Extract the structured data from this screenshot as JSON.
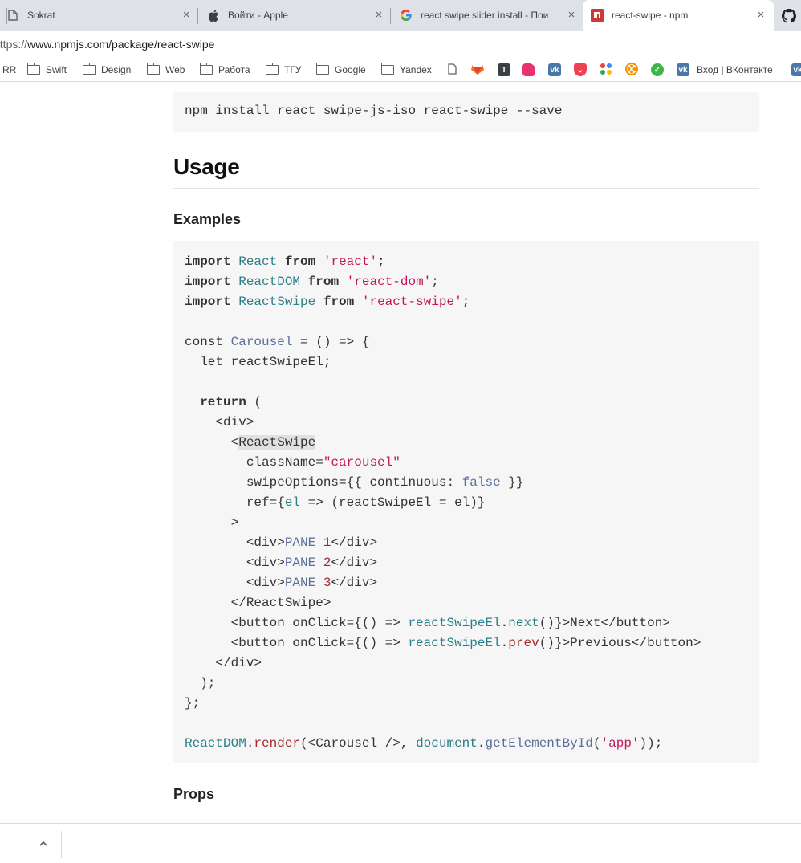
{
  "tabs": [
    {
      "title": "Sokrat",
      "icon": "document-icon",
      "close": "×"
    },
    {
      "title": "Войти - Apple",
      "icon": "apple-icon",
      "close": "×"
    },
    {
      "title": "react swipe slider install - Пои",
      "icon": "google-icon",
      "close": "×"
    },
    {
      "title": "react-swipe - npm",
      "icon": "npm-icon",
      "close": "×",
      "active": true
    }
  ],
  "address": {
    "url_dim": "https://",
    "url": "www.npmjs.com/package/react-swipe"
  },
  "bookmarks": [
    {
      "label": "RR",
      "type": "text"
    },
    {
      "label": "Swift",
      "type": "folder"
    },
    {
      "label": "Design",
      "type": "folder"
    },
    {
      "label": "Web",
      "type": "folder"
    },
    {
      "label": "Работа",
      "type": "folder"
    },
    {
      "label": "ТГУ",
      "type": "folder"
    },
    {
      "label": "Google",
      "type": "folder"
    },
    {
      "label": "Yandex",
      "type": "folder"
    },
    {
      "label": "",
      "type": "page-icon"
    },
    {
      "label": "",
      "type": "gitlab-icon"
    },
    {
      "label": "",
      "type": "tilda-icon"
    },
    {
      "label": "",
      "type": "pink-icon"
    },
    {
      "label": "",
      "type": "vk-icon"
    },
    {
      "label": "",
      "type": "pocket-icon"
    },
    {
      "label": "",
      "type": "dots-icon"
    },
    {
      "label": "",
      "type": "flower-icon"
    },
    {
      "label": "",
      "type": "green-icon"
    },
    {
      "label": "Вход | ВКонтакте",
      "type": "vk-icon"
    }
  ],
  "content": {
    "install_cmd": "npm install react swipe-js-iso react-swipe --save",
    "usage_heading": "Usage",
    "examples_heading": "Examples",
    "props_heading": "Props",
    "code": {
      "l1": [
        "import",
        "React",
        "from",
        "'react'",
        ";"
      ],
      "l2": [
        "import",
        "ReactDOM",
        "from",
        "'react-dom'",
        ";"
      ],
      "l3": [
        "import",
        "ReactSwipe",
        "from",
        "'react-swipe'",
        ";"
      ],
      "l5": [
        "const ",
        "Carousel",
        " = () => {"
      ],
      "l6": "  let reactSwipeEl;",
      "l8": [
        "  ",
        "return",
        " ("
      ],
      "l9": "    <div>",
      "l10": [
        "      <",
        "ReactSwipe"
      ],
      "l11": [
        "        className=",
        "\"carousel\""
      ],
      "l12": [
        "        swipeOptions={{ continuous: ",
        "false",
        " }}"
      ],
      "l13": [
        "        ref={",
        "el",
        " => (reactSwipeEl = el)}"
      ],
      "l14": "      >",
      "l15": [
        "        <div>",
        "PANE",
        " ",
        "1",
        "</div>"
      ],
      "l16": [
        "        <div>",
        "PANE",
        " ",
        "2",
        "</div>"
      ],
      "l17": [
        "        <div>",
        "PANE",
        " ",
        "3",
        "</div>"
      ],
      "l18": "      </ReactSwipe>",
      "l19": [
        "      <button onClick={() => ",
        "reactSwipeEl",
        ".",
        "next",
        "()}>Next</button>"
      ],
      "l20": [
        "      <button onClick={() => ",
        "reactSwipeEl",
        ".",
        "prev",
        "()}>Previous</button>"
      ],
      "l21": "    </div>",
      "l22": "  );",
      "l23": "};",
      "l25": [
        "ReactDOM",
        ".",
        "render",
        "(<Carousel />, ",
        "document",
        ".",
        "getElementById",
        "(",
        "'app'",
        "));"
      ]
    }
  },
  "colors": {
    "keyword": "#333333",
    "title": "#287f88",
    "string": "#c2185b",
    "literal": "#5c6e9a",
    "function": "#a4282c"
  }
}
